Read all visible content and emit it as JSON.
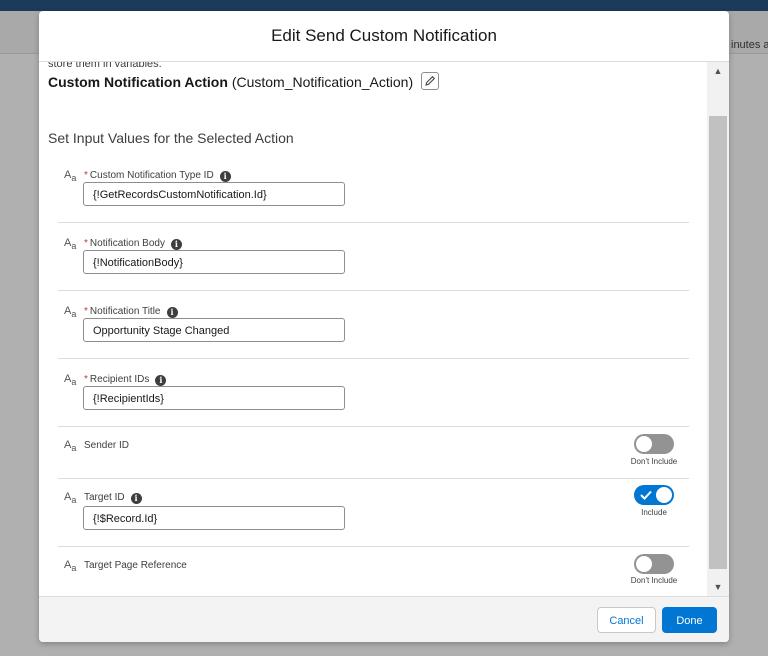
{
  "background": {
    "right_fragment": "inutes a"
  },
  "modal": {
    "title": "Edit Send Custom Notification",
    "cut_text": "store them in variables.",
    "action_name": "Custom Notification Action",
    "action_api": "(Custom_Notification_Action)",
    "section_title": "Set Input Values for the Selected Action",
    "type_icon_text": "A",
    "type_icon_sub": "a",
    "required_marker": "*",
    "info_glyph": "i",
    "fields": [
      {
        "label": "Custom Notification Type ID",
        "required": true,
        "value": "{!GetRecordsCustomNotification.Id}"
      },
      {
        "label": "Notification Body",
        "required": true,
        "value": "{!NotificationBody}"
      },
      {
        "label": "Notification Title",
        "required": true,
        "value": "Opportunity Stage Changed"
      },
      {
        "label": "Recipient IDs",
        "required": true,
        "value": "{!RecipientIds}"
      },
      {
        "label": "Sender ID",
        "required": false,
        "toggle": "off",
        "toggle_label": "Don't Include"
      },
      {
        "label": "Target ID",
        "required": false,
        "value": "{!$Record.Id}",
        "toggle": "on",
        "toggle_label": "Include"
      },
      {
        "label": "Target Page Reference",
        "required": false,
        "toggle": "off",
        "toggle_label": "Don't Include"
      }
    ],
    "scroll_up_glyph": "▲",
    "scroll_down_glyph": "▼",
    "cancel_label": "Cancel",
    "done_label": "Done"
  },
  "colors": {
    "brand": "#0176d3",
    "required": "#c23934",
    "toggle_off": "#939393"
  },
  "icons": [
    "pencil-icon",
    "info-icon",
    "text-type-icon",
    "check-icon"
  ]
}
